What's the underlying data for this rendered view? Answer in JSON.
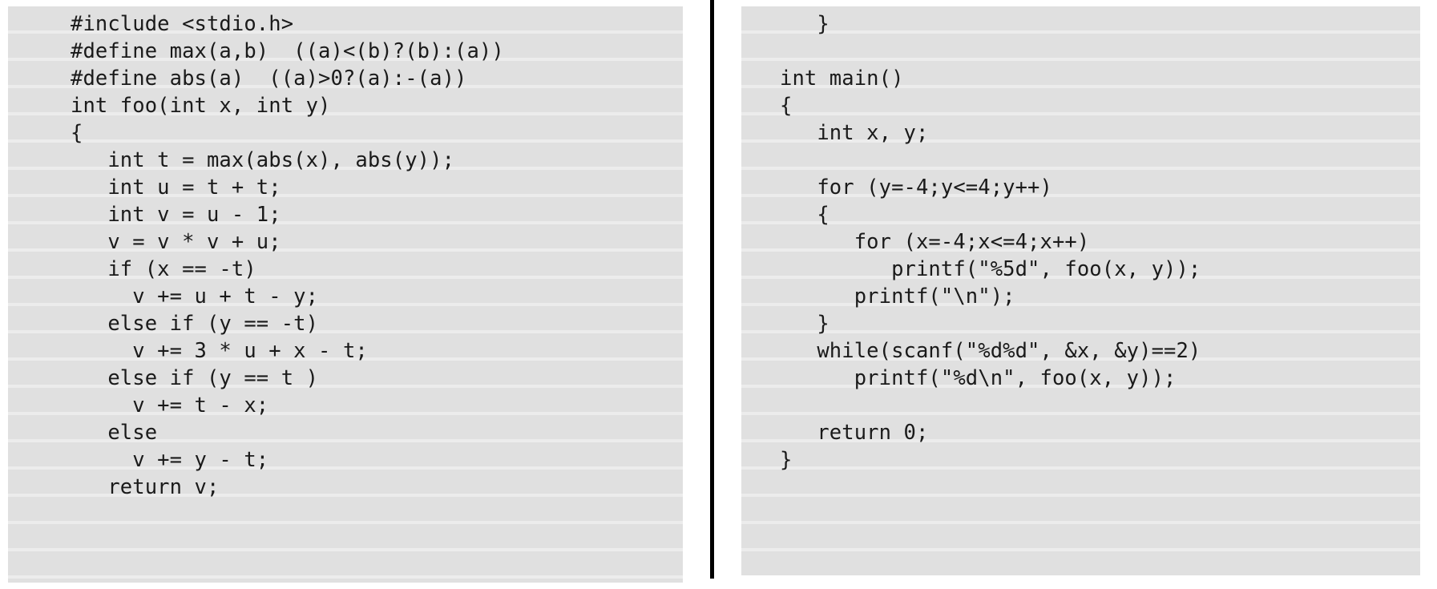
{
  "document": {
    "kind": "two-column-source-code-listing",
    "language": "C",
    "background_color": "#ffffff",
    "panel_color": "#e0e0e0",
    "text_color": "#1a1a1a",
    "divider_color": "#000000"
  },
  "left_column": {
    "name": "left-code-column",
    "lines": [
      "#include <stdio.h>",
      "#define max(a,b)  ((a)<(b)?(b):(a))",
      "#define abs(a)  ((a)>0?(a):-(a))",
      "int foo(int x, int y)",
      "{",
      "   int t = max(abs(x), abs(y));",
      "   int u = t + t;",
      "   int v = u - 1;",
      "   v = v * v + u;",
      "   if (x == -t)",
      "     v += u + t - y;",
      "   else if (y == -t)",
      "     v += 3 * u + x - t;",
      "   else if (y == t )",
      "     v += t - x;",
      "   else",
      "     v += y - t;",
      "   return v;"
    ]
  },
  "right_column": {
    "name": "right-code-column",
    "lines": [
      "   }",
      "",
      "int main()",
      "{",
      "   int x, y;",
      "",
      "   for (y=-4;y<=4;y++)",
      "   {",
      "      for (x=-4;x<=4;x++)",
      "         printf(\"%5d\", foo(x, y));",
      "      printf(\"\\n\");",
      "   }",
      "   while(scanf(\"%d%d\", &x, &y)==2)",
      "      printf(\"%d\\n\", foo(x, y));",
      "",
      "   return 0;",
      "}"
    ]
  }
}
